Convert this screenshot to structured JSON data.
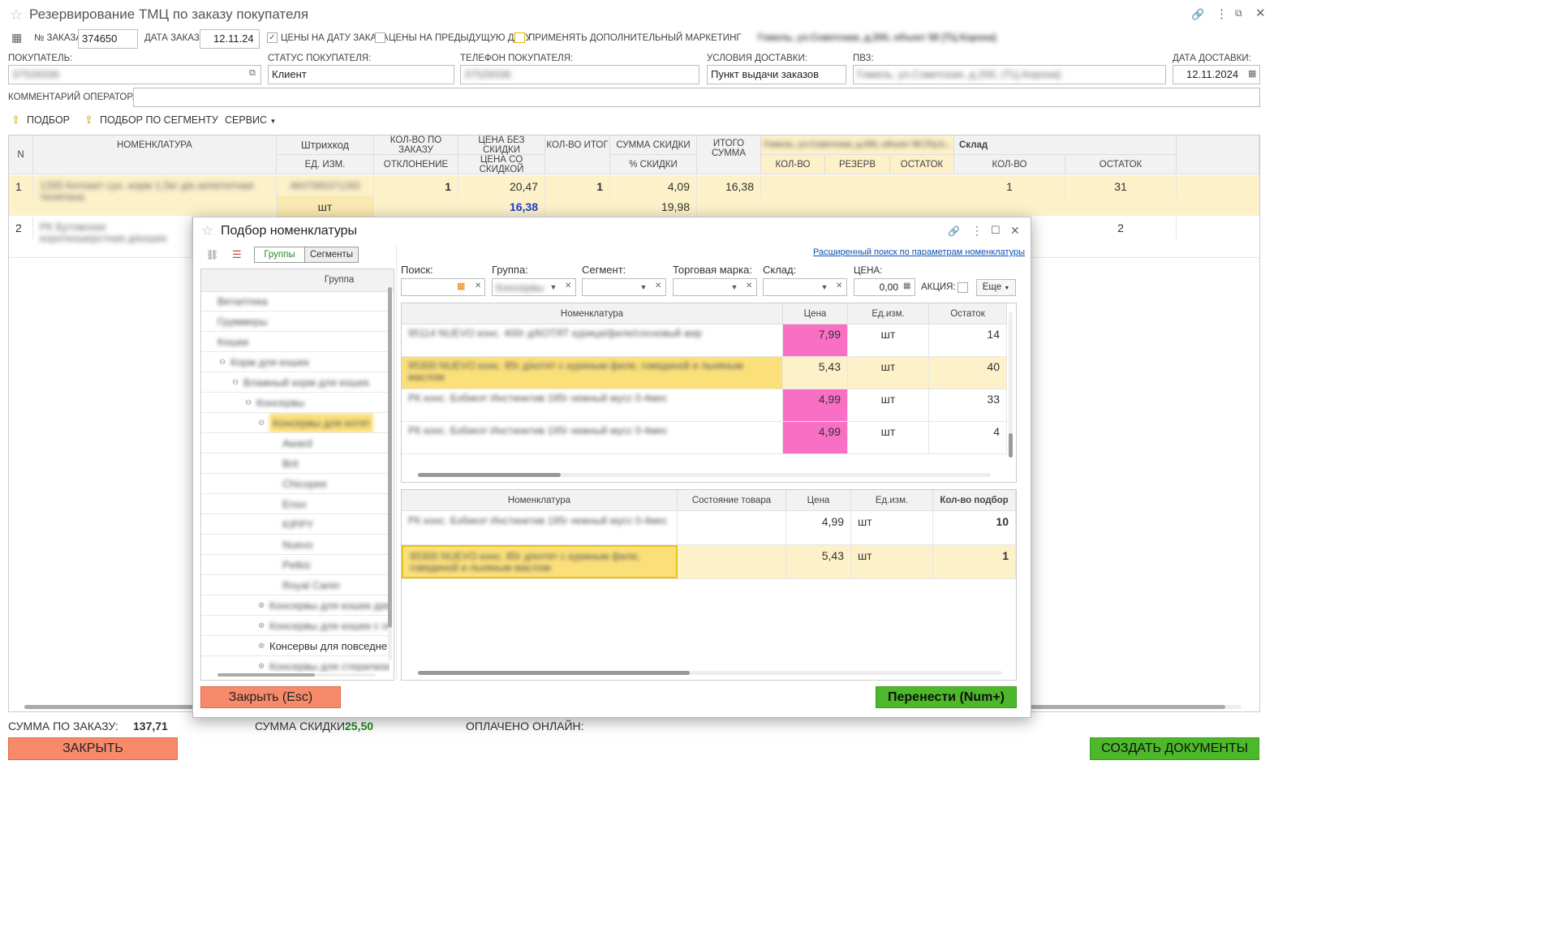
{
  "window": {
    "title": "Резервирование ТМЦ по заказу покупателя"
  },
  "order": {
    "number_label": "№ ЗАКАЗА:",
    "number": "374650",
    "date_label": "ДАТА ЗАКАЗА:",
    "date": "12.11.24",
    "cb_prices_on_date": "ЦЕНЫ НА ДАТУ ЗАКАЗА",
    "cb_prices_prev": "ЦЕНЫ НА ПРЕДЫДУЩУЮ ДАТУ",
    "cb_marketing": "ПРИМЕНЯТЬ ДОПОЛНИТЕЛЬНЫЙ МАРКЕТИНГ",
    "store_address": "Гомель, ул.Советская, д.200, объект 58 (ТЦ Корона)"
  },
  "customer": {
    "buyer_label": "ПОКУПАТЕЛЬ:",
    "buyer": "37529336",
    "status_label": "СТАТУС ПОКУПАТЕЛЯ:",
    "status": "Клиент",
    "phone_label": "ТЕЛЕФОН ПОКУПАТЕЛЯ:",
    "phone": "37529336",
    "delivery_label": "УСЛОВИЯ ДОСТАВКИ:",
    "delivery": "Пункт выдачи заказов",
    "pvz_label": "ПВЗ:",
    "pvz": "Гомель, ул.Советская, д.200, (ТЦ Корона)",
    "delivery_date_label": "ДАТА ДОСТАВКИ:",
    "delivery_date": "12.11.2024",
    "comment_label": "КОММЕНТАРИЙ ОПЕРАТОРА КЦ:",
    "comment": ""
  },
  "toolbar": {
    "pick": "ПОДБОР",
    "pick_segment": "ПОДБОР ПО СЕГМЕНТУ",
    "service": "СЕРВИС"
  },
  "main_table": {
    "headers": {
      "n": "N",
      "nomenclature": "НОМЕНКЛАТУРА",
      "barcode": "Штрихкод",
      "unit": "ЕД. ИЗМ.",
      "qty_order": "КОЛ-ВО ПО ЗАКАЗУ",
      "deviation": "ОТКЛОНЕНИЕ",
      "price_no_disc": "ЦЕНА БЕЗ СКИДКИ",
      "price_disc": "ЦЕНА СО СКИДКОЙ",
      "qty_total": "КОЛ-ВО ИТОГ",
      "disc_sum": "СУММА СКИДКИ",
      "disc_pct": "% СКИДКИ",
      "total_sum": "ИТОГО СУММА",
      "store_group": "Гомель, ул.Советская, д.200, объект 58 (ТЦ К...",
      "store_qty": "КОЛ-ВО",
      "store_reserve": "РЕЗЕРВ",
      "store_rest": "ОСТАТОК",
      "warehouse": "Склад",
      "wh_qty": "КОЛ-ВО",
      "wh_rest": "ОСТАТОК"
    },
    "rows": [
      {
        "n": "1",
        "name": "1265 Котокет сух. корм 1,5кг д/к аппетитная телятина",
        "barcode": "4607065371265",
        "unit": "шт",
        "qty_order": "1",
        "price_no_disc": "20,47",
        "price_disc": "16,38",
        "qty_total": "1",
        "disc_sum": "4,09",
        "disc_pct": "19,98",
        "total": "16,38",
        "wh_qty": "1",
        "wh_rest": "31"
      },
      {
        "n": "2",
        "name": "РК Бутовская короткошерстная д/кошек",
        "wh_rest": "2"
      }
    ]
  },
  "footer": {
    "sum_label": "СУММА ПО ЗАКАЗУ:",
    "sum": "137,71",
    "disc_label": "СУММА СКИДКИ:",
    "disc": "25,50",
    "paid_label": "ОПЛАЧЕНО ОНЛАЙН:",
    "paid": "",
    "close": "ЗАКРЫТЬ",
    "create_docs": "СОЗДАТЬ ДОКУМЕНТЫ"
  },
  "dialog": {
    "title": "Подбор номенклатуры",
    "tab_groups": "Группы",
    "tab_segments": "Сегменты",
    "ext_search": "Расширенный поиск по параметрам номенклатуры",
    "group_col": "Группа",
    "groups": [
      {
        "label": "Ветаптека",
        "level": 0
      },
      {
        "label": "Груммеры",
        "level": 0
      },
      {
        "label": "Кошки",
        "level": 0
      },
      {
        "label": "Корм для кошек",
        "level": 1,
        "mark": "⊖"
      },
      {
        "label": "Влажный корм для кошек",
        "level": 2,
        "mark": "⊖"
      },
      {
        "label": "Консервы",
        "level": 3,
        "mark": "⊖"
      },
      {
        "label": "Консервы для котят",
        "level": 4,
        "mark": "⊖",
        "selected": true
      },
      {
        "label": "Award",
        "level": 5
      },
      {
        "label": "Brit",
        "level": 5
      },
      {
        "label": "Chicopee",
        "level": 5
      },
      {
        "label": "Enso",
        "level": 5
      },
      {
        "label": "KIPPY",
        "level": 5
      },
      {
        "label": "Nuevo",
        "level": 5
      },
      {
        "label": "Petkic",
        "level": 5
      },
      {
        "label": "Royal Canin",
        "level": 5
      },
      {
        "label": "Консервы для кошек диетические",
        "level": 4,
        "mark": "⊕"
      },
      {
        "label": "Консервы для кошек с особыми потребностями",
        "level": 4,
        "mark": "⊕"
      },
      {
        "label": "Консервы для повседневного кормления",
        "level": 4,
        "mark": "⊕",
        "clear": true
      },
      {
        "label": "Консервы для стерилизованных",
        "level": 4,
        "mark": "⊕"
      }
    ],
    "filters": {
      "search_label": "Поиск:",
      "group_label": "Группа:",
      "group_value": "Консервы",
      "segment_label": "Сегмент:",
      "brand_label": "Торговая марка:",
      "store_label": "Склад:",
      "price_label": "ЦЕНА:",
      "price_value": "0,00",
      "promo_label": "АКЦИЯ:",
      "more": "Еще"
    },
    "upper_headers": {
      "name": "Номенклатура",
      "price": "Цена",
      "unit": "Ед.изм.",
      "rest": "Остаток"
    },
    "upper_rows": [
      {
        "name": "95114 NUEVO конс. 400г д/КОТЯТ курица/филе/сосновый жир",
        "price": "7,99",
        "unit": "шт",
        "rest": "14",
        "promo": true
      },
      {
        "name": "95300 NUEVO конс. 85г д/котят с куриным филе, говядиной и льняным маслом",
        "price": "5,43",
        "unit": "шт",
        "rest": "40",
        "selected": true
      },
      {
        "name": "РК конс. Бэбикэт Инстинктив 195г нежный мусс 0-4мес",
        "price": "4,99",
        "unit": "шт",
        "rest": "33",
        "promo": true
      },
      {
        "name": "РК конс. Бэбикэт Инстинктив 195г нежный мусс 0-4мес",
        "price": "4,99",
        "unit": "шт",
        "rest": "4",
        "promo": true
      }
    ],
    "lower_headers": {
      "name": "Номенклатура",
      "state": "Состояние товара",
      "price": "Цена",
      "unit": "Ед.изм.",
      "qty": "Кол-во подбор"
    },
    "lower_rows": [
      {
        "name": "РК конс. Бэбикэт Инстинктив 195г нежный мусс 0-4мес",
        "state": "",
        "price": "4,99",
        "unit": "шт",
        "qty": "10"
      },
      {
        "name": "95300 NUEVO конс. 85г д/котят с куриным филе, говядиной и льняным маслом",
        "state": "",
        "price": "5,43",
        "unit": "шт",
        "qty": "1",
        "selected": true
      }
    ],
    "close_btn": "Закрыть (Esc)",
    "transfer_btn": "Перенести (Num+)"
  },
  "colors": {
    "promo_pink": "#f86fc3",
    "row_yellow": "#fdf1c9",
    "select_yellow": "#fbe07a",
    "green": "#4cb82a",
    "orange": "#f78a6a",
    "link": "#0b54b8"
  }
}
